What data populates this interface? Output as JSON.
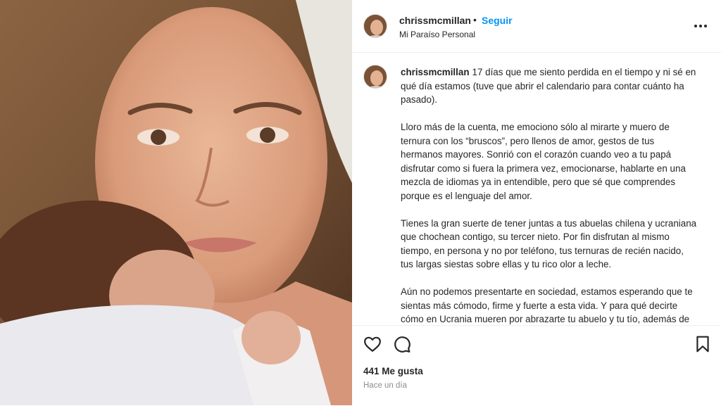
{
  "post": {
    "username": "chrissmcmillan",
    "separator": "•",
    "follow_label": "Seguir",
    "location": "Mi Paraíso Personal",
    "more_icon": "more-options-icon"
  },
  "caption": {
    "username": "chrissmcmillan",
    "paragraphs": [
      "17 días que me siento perdida en el tiempo y ni sé en qué día estamos (tuve que abrir el calendario para contar cuánto ha pasado).",
      "Lloro más de la cuenta, me emociono sólo al mirarte y muero de ternura con los “bruscos”, pero llenos de amor, gestos de tus hermanos mayores. Sonrió con el corazón cuando veo a tu papá disfrutar como si fuera la primera vez, emocionarse, hablarte en una mezcla de idiomas ya in entendible, pero que sé que comprendes porque es el lenguaje del amor.",
      "Tienes la gran suerte de tener juntas a tus abuelas chilena y ucraniana que chochean contigo, su tercer nieto. Por fin disfrutan al mismo tiempo, en persona y no por teléfono, tus ternuras de recién nacido, tus largas siestas sobre ellas y tu rico olor a leche.",
      "Aún no podemos presentarte en sociedad, estamos esperando que te sientas más cómodo, firme y fuerte a esta vida. Y para qué decirte cómo en Ucrania mueren por abrazarte tu abuelo y tu tío, además de todos los amigos. Pero de a poquito, ya llegará ese momento."
    ]
  },
  "actions": {
    "like_icon": "heart-icon",
    "comment_icon": "comment-icon",
    "save_icon": "bookmark-icon",
    "likes_text": "441 Me gusta",
    "time_text": "Hace un día"
  }
}
